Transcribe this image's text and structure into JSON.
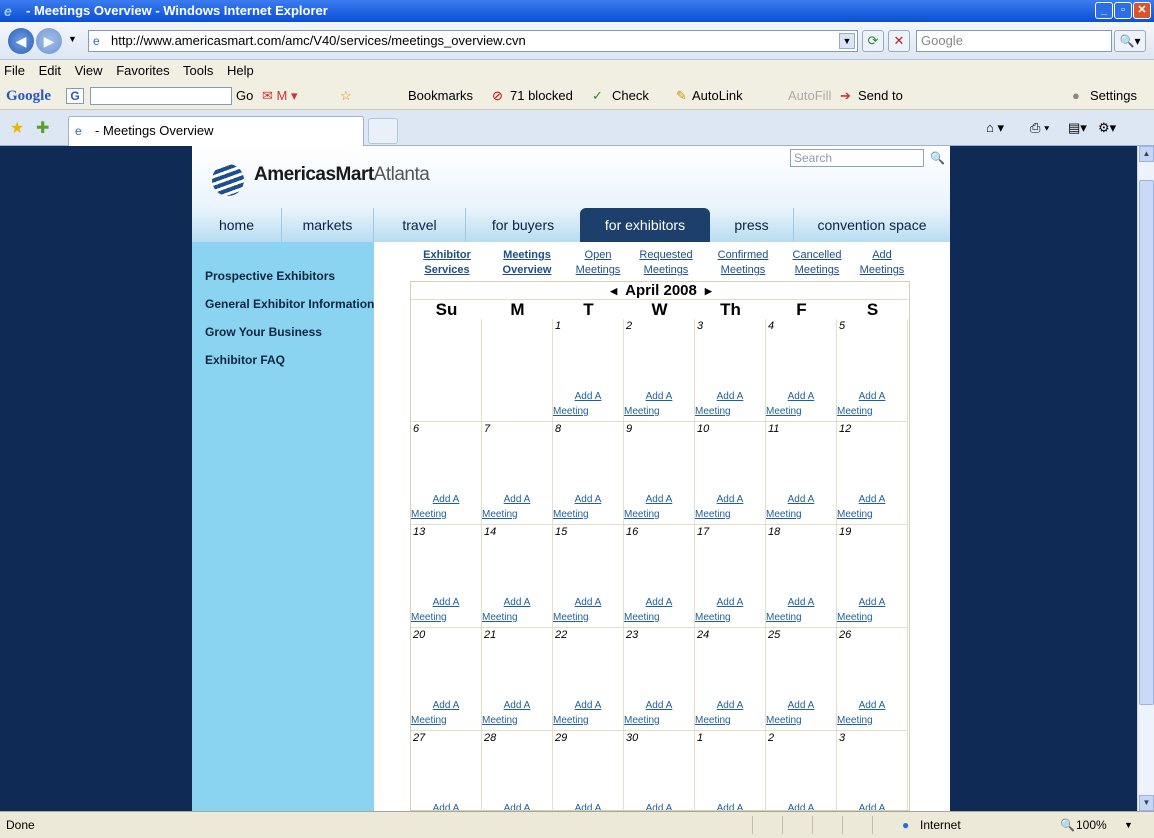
{
  "window": {
    "title": " - Meetings Overview - Windows Internet Explorer"
  },
  "address": {
    "url": "http://www.americasmart.com/amc/V40/services/meetings_overview.cvn",
    "search_placeholder": "Google"
  },
  "menu": [
    "File",
    "Edit",
    "View",
    "Favorites",
    "Tools",
    "Help"
  ],
  "google_toolbar": {
    "logo": "Google",
    "go": "Go",
    "bookmarks": "Bookmarks",
    "blocked": "71 blocked",
    "check": "Check",
    "autolink": "AutoLink",
    "autofill": "AutoFill",
    "sendto": "Send to",
    "settings": "Settings"
  },
  "tab": {
    "title": " - Meetings Overview"
  },
  "site": {
    "logo_main": "AmericasMart",
    "logo_city": "Atlanta",
    "search_placeholder": "Search",
    "nav": [
      "home",
      "markets",
      "travel",
      "for buyers",
      "for exhibitors",
      "press",
      "convention space"
    ],
    "active_nav": "for exhibitors",
    "sidebar": [
      "Prospective Exhibitors",
      "General Exhibitor Information",
      "Grow Your Business",
      "Exhibitor FAQ"
    ],
    "subnav": [
      {
        "line1": "Exhibitor",
        "line2": "Services"
      },
      {
        "line1": "Meetings",
        "line2": "Overview"
      },
      {
        "line1": "Open",
        "line2": "Meetings"
      },
      {
        "line1": "Requested",
        "line2": "Meetings"
      },
      {
        "line1": "Confirmed",
        "line2": "Meetings"
      },
      {
        "line1": "Cancelled",
        "line2": "Meetings"
      },
      {
        "line1": "Add",
        "line2": "Meetings"
      }
    ]
  },
  "calendar": {
    "month": "April 2008",
    "weekdays": [
      "Su",
      "M",
      "T",
      "W",
      "Th",
      "F",
      "S"
    ],
    "add_line1": "Add A",
    "add_line2": "Meeting",
    "weeks": [
      [
        "",
        "",
        "1",
        "2",
        "3",
        "4",
        "5"
      ],
      [
        "6",
        "7",
        "8",
        "9",
        "10",
        "11",
        "12"
      ],
      [
        "13",
        "14",
        "15",
        "16",
        "17",
        "18",
        "19"
      ],
      [
        "20",
        "21",
        "22",
        "23",
        "24",
        "25",
        "26"
      ],
      [
        "27",
        "28",
        "29",
        "30",
        "1",
        "2",
        "3"
      ]
    ]
  },
  "status": {
    "left": "Done",
    "zone": "Internet",
    "zoom": "100%"
  }
}
